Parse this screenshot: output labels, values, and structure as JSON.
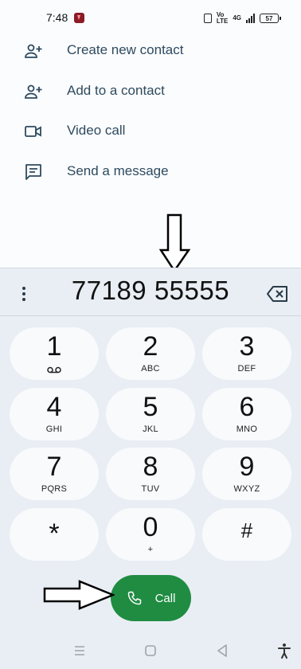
{
  "status_bar": {
    "time": "7:48",
    "battery": "57",
    "network": "4G"
  },
  "suggestions": [
    {
      "label": "Create new contact",
      "icon": "add-person-icon"
    },
    {
      "label": "Add to a contact",
      "icon": "add-person-icon"
    },
    {
      "label": "Video call",
      "icon": "video-camera-icon"
    },
    {
      "label": "Send a message",
      "icon": "message-icon"
    }
  ],
  "dialer": {
    "number": "77189 55555",
    "keys": [
      {
        "digit": "1",
        "letters": ""
      },
      {
        "digit": "2",
        "letters": "ABC"
      },
      {
        "digit": "3",
        "letters": "DEF"
      },
      {
        "digit": "4",
        "letters": "GHI"
      },
      {
        "digit": "5",
        "letters": "JKL"
      },
      {
        "digit": "6",
        "letters": "MNO"
      },
      {
        "digit": "7",
        "letters": "PQRS"
      },
      {
        "digit": "8",
        "letters": "TUV"
      },
      {
        "digit": "9",
        "letters": "WXYZ"
      },
      {
        "digit": "*",
        "letters": ""
      },
      {
        "digit": "0",
        "letters": "+"
      },
      {
        "digit": "#",
        "letters": ""
      }
    ],
    "call_label": "Call"
  },
  "colors": {
    "accent_text": "#2d4a5e",
    "call_green": "#1f8c42",
    "dialer_bg": "#e9eef4",
    "key_bg": "#f8fafc"
  }
}
